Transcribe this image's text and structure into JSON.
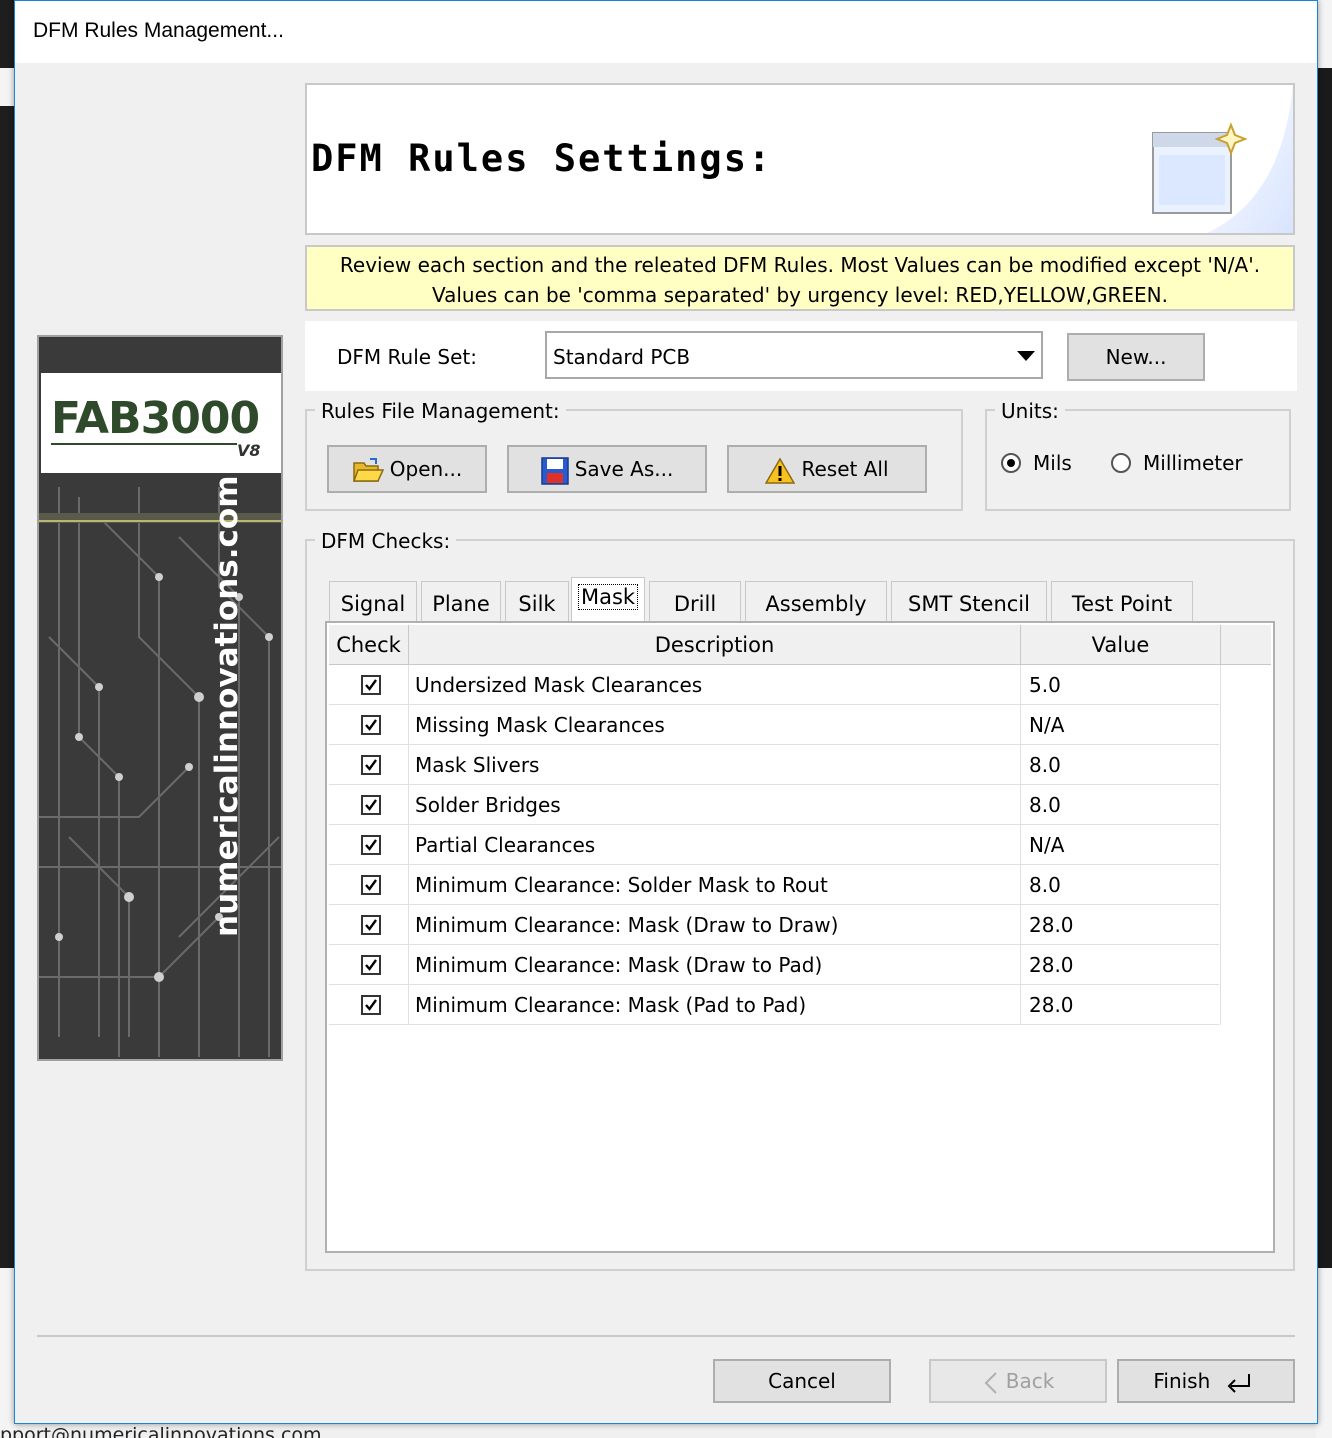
{
  "background": {
    "email_fragment": "pport@numericalinnovations.com"
  },
  "dialog": {
    "title": "DFM Rules Management..."
  },
  "banner": {
    "logo": "FAB3000",
    "version": "V8",
    "website": "numericalinnovations.com"
  },
  "header": {
    "title": "DFM Rules Settings:"
  },
  "info": {
    "line1": "Review each section and the releated DFM Rules. Most Values can be modified except 'N/A'.",
    "line2": "Values can be 'comma separated' by urgency level: RED,YELLOW,GREEN."
  },
  "ruleset": {
    "label": "DFM Rule Set:",
    "selected": "Standard PCB",
    "new_button": "New..."
  },
  "file_management": {
    "label": "Rules File Management:",
    "open": "Open...",
    "save_as": "Save As...",
    "reset_all": "Reset All"
  },
  "units": {
    "label": "Units:",
    "options": [
      "Mils",
      "Millimeter"
    ],
    "selected": "Mils"
  },
  "checks": {
    "label": "DFM Checks:",
    "tabs": [
      "Signal",
      "Plane",
      "Silk",
      "Mask",
      "Drill",
      "Assembly",
      "SMT Stencil",
      "Test Point"
    ],
    "active_tab": "Mask",
    "columns": [
      "Check",
      "Description",
      "Value"
    ],
    "rows": [
      {
        "checked": true,
        "description": "Undersized Mask Clearances",
        "value": "5.0"
      },
      {
        "checked": true,
        "description": "Missing Mask Clearances",
        "value": "N/A"
      },
      {
        "checked": true,
        "description": "Mask Slivers",
        "value": "8.0"
      },
      {
        "checked": true,
        "description": "Solder Bridges",
        "value": "8.0"
      },
      {
        "checked": true,
        "description": "Partial Clearances",
        "value": "N/A"
      },
      {
        "checked": true,
        "description": "Minimum Clearance: Solder Mask to Rout",
        "value": "8.0"
      },
      {
        "checked": true,
        "description": "Minimum Clearance: Mask (Draw to Draw)",
        "value": "28.0"
      },
      {
        "checked": true,
        "description": "Minimum Clearance: Mask (Draw to Pad)",
        "value": "28.0"
      },
      {
        "checked": true,
        "description": "Minimum Clearance: Mask (Pad to Pad)",
        "value": "28.0"
      }
    ]
  },
  "footer": {
    "cancel": "Cancel",
    "back": "Back",
    "finish": "Finish"
  },
  "colors": {
    "info_background": "#ffffc4",
    "dialog_border": "#1883d7"
  }
}
